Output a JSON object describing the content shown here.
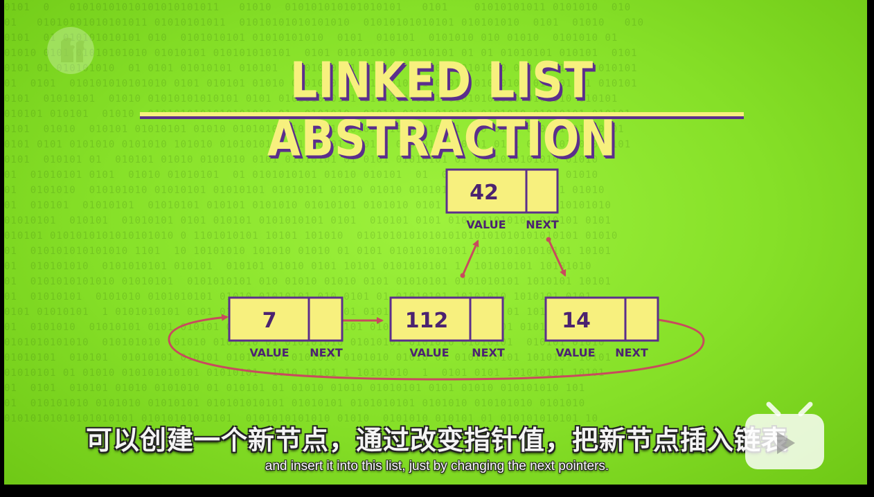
{
  "video": {
    "title": "LINKED LIST ABSTRACTION",
    "colors": {
      "background": "#8fe630",
      "node_fill": "#f7f07e",
      "node_stroke": "#5b2e8c",
      "arrow": "#c84a5e"
    },
    "nodes": [
      {
        "value": "7",
        "value_label": "VALUE",
        "next_label": "NEXT"
      },
      {
        "value": "112",
        "value_label": "VALUE",
        "next_label": "NEXT"
      },
      {
        "value": "42",
        "value_label": "VALUE",
        "next_label": "NEXT"
      },
      {
        "value": "14",
        "value_label": "VALUE",
        "next_label": "NEXT"
      }
    ]
  },
  "subtitles": {
    "chinese": "可以创建一个新节点，通过改变指针值，把新节点插入链表",
    "english": "and insert it into this list, just by changing the next pointers."
  },
  "overlay": {
    "logo_icon": "pbs-logo-icon",
    "player_icon": "tv-play-icon"
  }
}
